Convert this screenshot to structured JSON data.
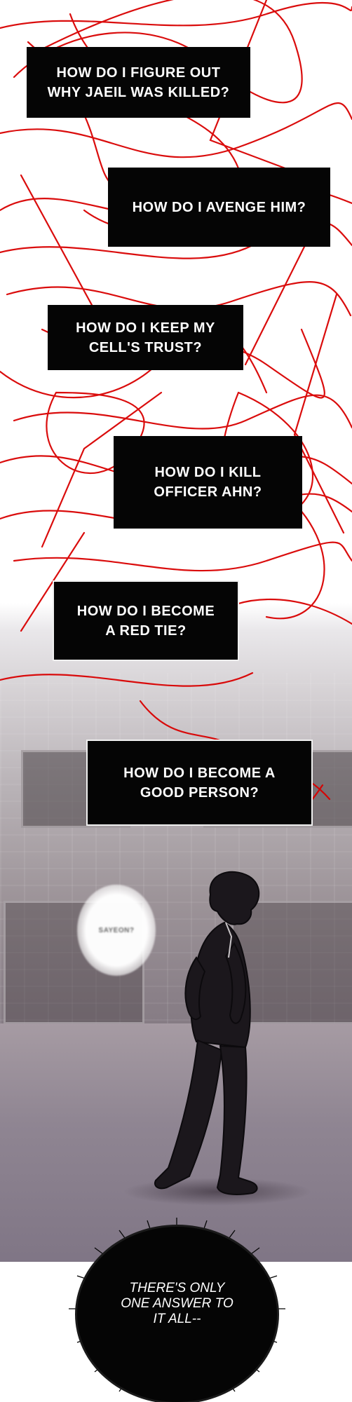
{
  "captions": [
    {
      "text": "HOW DO I FIGURE OUT\nWHY JAEIL WAS KILLED?"
    },
    {
      "text": "HOW DO I AVENGE HIM?"
    },
    {
      "text": "HOW DO I KEEP MY\nCELL'S TRUST?"
    },
    {
      "text": "HOW DO I KILL\nOFFICER AHN?"
    },
    {
      "text": "HOW DO I BECOME\nA RED TIE?"
    },
    {
      "text": "HOW DO I BECOME A\nGOOD PERSON?"
    }
  ],
  "speech_bubble": {
    "text": "SAYEON?"
  },
  "narration_burst": {
    "text": "THERE'S ONLY\nONE ANSWER TO\nIT ALL--"
  },
  "colors": {
    "scribble": "#d90000",
    "caption_bg": "#050505",
    "caption_text": "#ffffff"
  },
  "icons": [
    "red-scribble-background",
    "walking-figure",
    "speech-bubble",
    "narration-burst"
  ]
}
